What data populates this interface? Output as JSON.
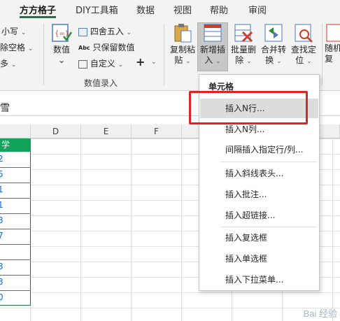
{
  "tabs": [
    {
      "label": "方方格子",
      "active": true
    },
    {
      "label": "DIY工具箱",
      "active": false
    },
    {
      "label": "数据",
      "active": false
    },
    {
      "label": "视图",
      "active": false
    },
    {
      "label": "帮助",
      "active": false
    },
    {
      "label": "审阅",
      "active": false
    }
  ],
  "ribbon": {
    "left_partial": {
      "small_case": "小写",
      "remove_spaces": "除空格",
      "more": "多"
    },
    "numeric": {
      "value_label": "数值",
      "round_label": "四舍五入",
      "keep_value_label": "只保留数值",
      "custom_label": "自定义",
      "plus_label": "+",
      "group_label": "数值录入"
    },
    "buttons": [
      {
        "line1": "复制粘",
        "line2": "贴"
      },
      {
        "line1": "新增插",
        "line2": "入"
      },
      {
        "line1": "批量删",
        "line2": "除"
      },
      {
        "line1": "合并转",
        "line2": "换"
      },
      {
        "line1": "查找定",
        "line2": "位"
      },
      {
        "line1": "随机",
        "line2": "复"
      }
    ]
  },
  "formula_bar": {
    "text": "雪"
  },
  "columns": [
    "D",
    "E",
    "F"
  ],
  "sheet": {
    "header_cell": "学",
    "row_digits": [
      "2",
      "5",
      "1",
      "1",
      "3",
      "7",
      "3",
      "3",
      "0"
    ]
  },
  "menu": {
    "title": "单元格",
    "items": [
      "插入N行...",
      "插入N列...",
      "间隔插入指定行/列...",
      "插入斜线表头...",
      "插入批注...",
      "插入超链接...",
      "插入复选框",
      "插入单选框",
      "插入下拉菜单..."
    ]
  },
  "watermark": "Bai 经验"
}
